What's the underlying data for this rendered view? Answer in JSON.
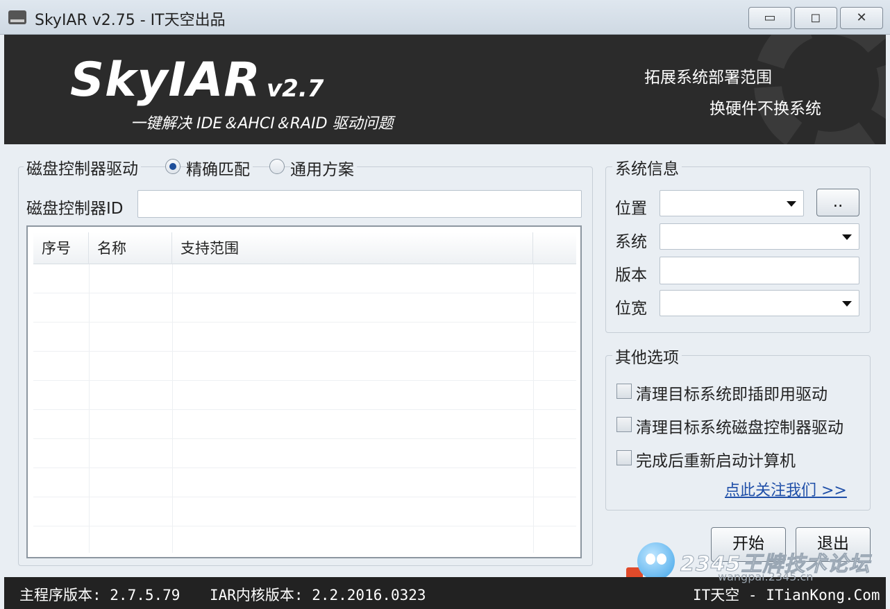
{
  "window": {
    "title": "SkyIAR v2.75 - IT天空出品",
    "minimize_glyph": "▭",
    "maximize_glyph": "◻",
    "close_glyph": "✕"
  },
  "banner": {
    "logo": "SkyIAR",
    "version": "v2.7",
    "subtitle": "一键解决 IDE＆AHCI＆RAID 驱动问题",
    "right_line1": "拓展系统部署范围",
    "right_line2": "换硬件不换系统"
  },
  "driver_group": {
    "label": "磁盘控制器驱动",
    "radio_exact": "精确匹配",
    "radio_generic": "通用方案",
    "selected": "精确匹配",
    "controller_id_label": "磁盘控制器ID",
    "controller_id_value": "",
    "columns": [
      "序号",
      "名称",
      "支持范围"
    ]
  },
  "system_info": {
    "label": "系统信息",
    "location_label": "位置",
    "location_value": "",
    "browse_label": "..",
    "system_label": "系统",
    "system_value": "",
    "version_label": "版本",
    "version_value": "",
    "bitness_label": "位宽",
    "bitness_value": ""
  },
  "other_options": {
    "label": "其他选项",
    "opt1": "清理目标系统即插即用驱动",
    "opt2": "清理目标系统磁盘控制器驱动",
    "opt3": "完成后重新启动计算机",
    "follow_link": "点此关注我们 >>"
  },
  "actions": {
    "start": "开始",
    "exit": "退出"
  },
  "status": {
    "main_version": "主程序版本: 2.7.5.79",
    "core_version": "IAR内核版本: 2.2.2016.0323",
    "site": "IT天空 - ITianKong.Com"
  },
  "watermark": {
    "brand": "2345王牌技术论坛",
    "url": "wangpai.2345.cn"
  }
}
